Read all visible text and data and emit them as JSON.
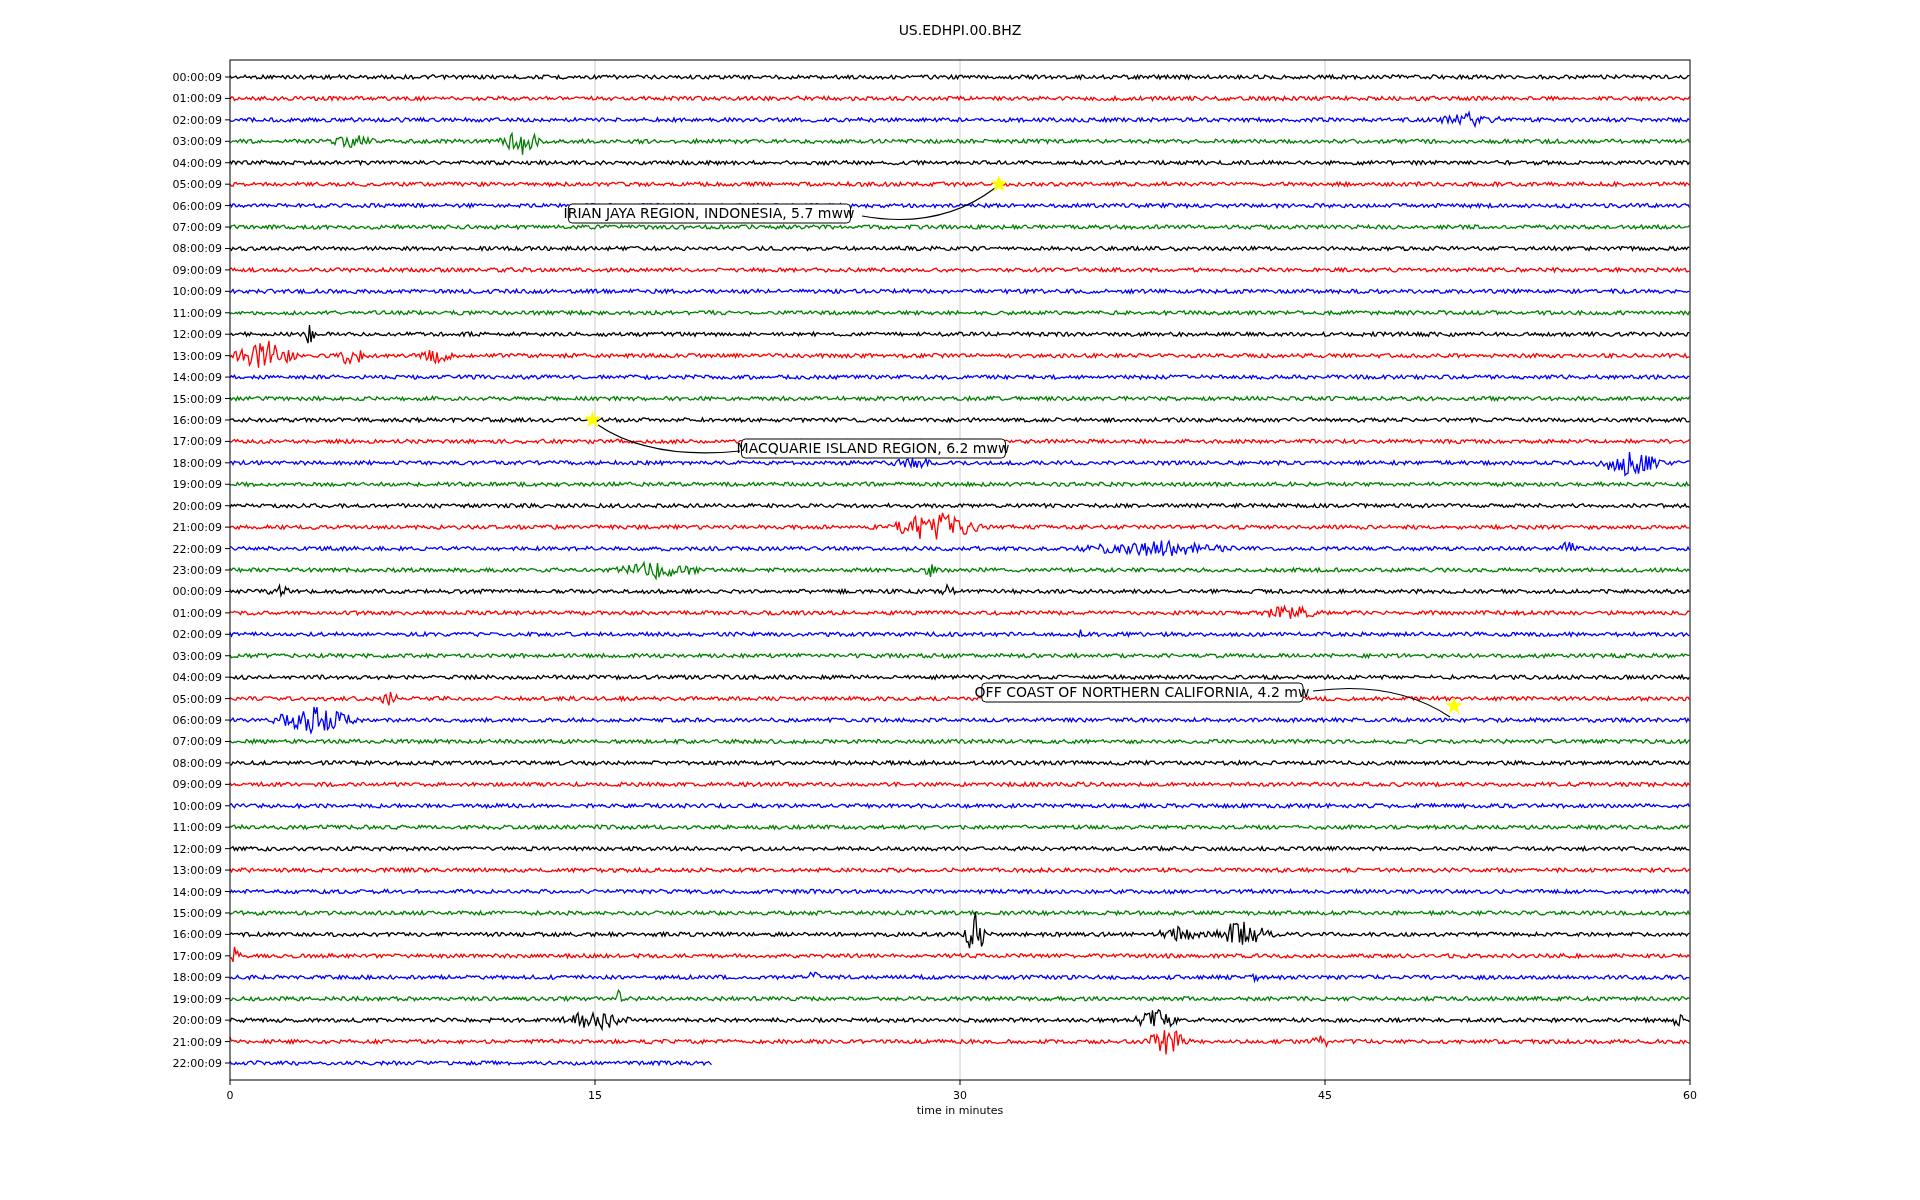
{
  "title": "US.EDHPI.00.BHZ",
  "rows": [
    {
      "label": "00:00:09",
      "color": "#000000"
    },
    {
      "label": "01:00:09",
      "color": "#ff0000"
    },
    {
      "label": "02:00:09",
      "color": "#0000ff"
    },
    {
      "label": "03:00:09",
      "color": "#008000"
    },
    {
      "label": "04:00:09",
      "color": "#000000"
    },
    {
      "label": "05:00:09",
      "color": "#ff0000"
    },
    {
      "label": "06:00:09",
      "color": "#0000ff"
    },
    {
      "label": "07:00:09",
      "color": "#008000"
    },
    {
      "label": "08:00:09",
      "color": "#000000"
    },
    {
      "label": "09:00:09",
      "color": "#ff0000"
    },
    {
      "label": "10:00:09",
      "color": "#0000ff"
    },
    {
      "label": "11:00:09",
      "color": "#008000"
    },
    {
      "label": "12:00:09",
      "color": "#000000"
    },
    {
      "label": "13:00:09",
      "color": "#ff0000"
    },
    {
      "label": "14:00:09",
      "color": "#0000ff"
    },
    {
      "label": "15:00:09",
      "color": "#008000"
    },
    {
      "label": "16:00:09",
      "color": "#000000"
    },
    {
      "label": "17:00:09",
      "color": "#ff0000"
    },
    {
      "label": "18:00:09",
      "color": "#0000ff"
    },
    {
      "label": "19:00:09",
      "color": "#008000"
    },
    {
      "label": "20:00:09",
      "color": "#000000"
    },
    {
      "label": "21:00:09",
      "color": "#ff0000"
    },
    {
      "label": "22:00:09",
      "color": "#0000ff"
    },
    {
      "label": "23:00:09",
      "color": "#008000"
    },
    {
      "label": "00:00:09",
      "color": "#000000"
    },
    {
      "label": "01:00:09",
      "color": "#ff0000"
    },
    {
      "label": "02:00:09",
      "color": "#0000ff"
    },
    {
      "label": "03:00:09",
      "color": "#008000"
    },
    {
      "label": "04:00:09",
      "color": "#000000"
    },
    {
      "label": "05:00:09",
      "color": "#ff0000"
    },
    {
      "label": "06:00:09",
      "color": "#0000ff"
    },
    {
      "label": "07:00:09",
      "color": "#008000"
    },
    {
      "label": "08:00:09",
      "color": "#000000"
    },
    {
      "label": "09:00:09",
      "color": "#ff0000"
    },
    {
      "label": "10:00:09",
      "color": "#0000ff"
    },
    {
      "label": "11:00:09",
      "color": "#008000"
    },
    {
      "label": "12:00:09",
      "color": "#000000"
    },
    {
      "label": "13:00:09",
      "color": "#ff0000"
    },
    {
      "label": "14:00:09",
      "color": "#0000ff"
    },
    {
      "label": "15:00:09",
      "color": "#008000"
    },
    {
      "label": "16:00:09",
      "color": "#000000"
    },
    {
      "label": "17:00:09",
      "color": "#ff0000"
    },
    {
      "label": "18:00:09",
      "color": "#0000ff"
    },
    {
      "label": "19:00:09",
      "color": "#008000"
    },
    {
      "label": "20:00:09",
      "color": "#000000"
    },
    {
      "label": "21:00:09",
      "color": "#ff0000"
    },
    {
      "label": "22:00:09",
      "color": "#0000ff"
    }
  ],
  "x_ticks": [
    "0",
    "15",
    "30",
    "45",
    "60"
  ],
  "xlabel": "time in minutes",
  "annotations": [
    {
      "text": "IRIAN JAYA REGION, INDONESIA, 5.7 mww"
    },
    {
      "text": "MACQUARIE ISLAND REGION, 6.2 mww"
    },
    {
      "text": "OFF COAST OF NORTHERN CALIFORNIA, 4.2 mw"
    }
  ]
}
